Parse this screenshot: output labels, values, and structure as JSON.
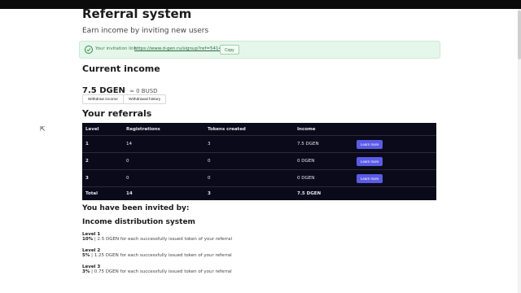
{
  "page": {
    "title": "Referral system",
    "subtitle": "Earn income by inviting new users"
  },
  "invite": {
    "label": "Your invitation link:",
    "link": "https://www.d-gen.ru/signup?ref=541455",
    "copy_label": "Copy"
  },
  "income": {
    "heading": "Current income",
    "amount": "7.5 DGEN",
    "busd": "≈ 0 BUSD",
    "withdraw_label": "Withdraw income",
    "history_label": "Withdrawal history"
  },
  "referrals": {
    "heading": "Your referrals",
    "columns": [
      "Level",
      "Registrations",
      "Tokens created",
      "Income"
    ],
    "rows": [
      {
        "level": "1",
        "registrations": "14",
        "tokens": "3",
        "income": "7.5 DGEN",
        "action": "Learn more"
      },
      {
        "level": "2",
        "registrations": "0",
        "tokens": "0",
        "income": "0 DGEN",
        "action": "Learn more"
      },
      {
        "level": "3",
        "registrations": "0",
        "tokens": "0",
        "income": "0 DGEN",
        "action": "Learn more"
      }
    ],
    "total": {
      "label": "Total",
      "registrations": "14",
      "tokens": "3",
      "income": "7.5 DGEN"
    }
  },
  "invited_by": {
    "heading": "You have been invited by:"
  },
  "distribution": {
    "heading": "Income distribution system",
    "levels": [
      {
        "title": "Level 1",
        "percent": "10%",
        "text": "| 2.5 DGEN for each successfully issued token of your referral"
      },
      {
        "title": "Level 2",
        "percent": "5%",
        "text": "| 1.25 DGEN for each successfully issued token of your referral"
      },
      {
        "title": "Level 3",
        "percent": "3%",
        "text": "| 0.75 DGEN for each successfully issued token of your referral"
      }
    ]
  },
  "colors": {
    "accent": "#5b5be6",
    "table_bg": "#0a0a1a",
    "invite_bg": "#e5f6ea"
  },
  "icons": {
    "invite": "check-circle-icon",
    "cursor": "mouse-cursor-icon"
  }
}
